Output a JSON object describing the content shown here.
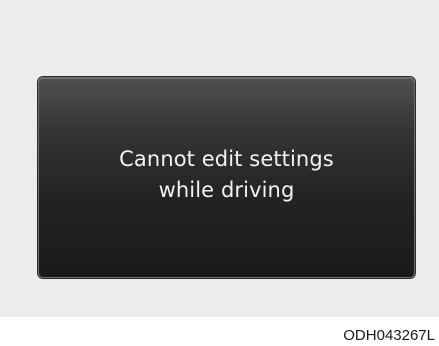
{
  "display": {
    "message_line1": "Cannot edit settings",
    "message_line2": "while driving"
  },
  "figure": {
    "code": "ODH043267L"
  },
  "colors": {
    "background": "#ececec",
    "screen": "#1f1f1f",
    "text": "#f2f2f2"
  }
}
